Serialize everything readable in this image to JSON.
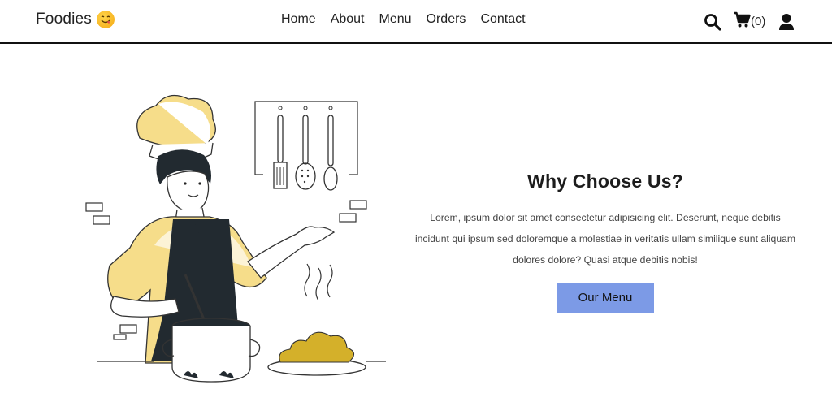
{
  "brand": {
    "name": "Foodies",
    "emoji_icon": "smiling-face-savoring-food-icon"
  },
  "nav": {
    "items": [
      {
        "label": "Home"
      },
      {
        "label": "About"
      },
      {
        "label": "Menu"
      },
      {
        "label": "Orders"
      },
      {
        "label": "Contact"
      }
    ]
  },
  "header_actions": {
    "search_icon": "search-icon",
    "cart_icon": "cart-icon",
    "cart_count": "(0)",
    "user_icon": "user-icon"
  },
  "hero": {
    "illustration": "chef-cooking-illustration",
    "title": "Why Choose Us?",
    "description": "Lorem, ipsum dolor sit amet consectetur adipisicing elit. Deserunt, neque debitis incidunt qui ipsum sed doloremque a molestiae in veritatis ullam similique sunt aliquam dolores dolore? Quasi atque debitis nobis!",
    "button_label": "Our Menu"
  },
  "colors": {
    "accent_button": "#7c9ae6",
    "illustration_yellow": "#f6dd8a",
    "illustration_dark": "#222a30",
    "food_gold": "#d4b02a"
  }
}
